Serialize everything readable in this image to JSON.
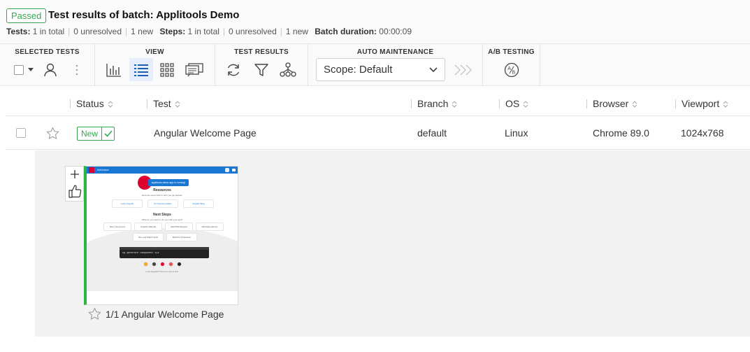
{
  "header": {
    "status": "Passed",
    "title": "Test results of batch: Applitools Demo",
    "tests_label": "Tests:",
    "tests_total": "1 in total",
    "tests_unresolved": "0 unresolved",
    "tests_new": "1 new",
    "steps_label": "Steps:",
    "steps_total": "1 in total",
    "steps_unresolved": "0 unresolved",
    "steps_new": "1 new",
    "duration_label": "Batch duration:",
    "duration_value": "00:00:09"
  },
  "toolbar": {
    "selected_tests": "SELECTED TESTS",
    "view": "VIEW",
    "test_results": "TEST RESULTS",
    "auto_maintenance": "AUTO MAINTENANCE",
    "ab_testing": "A/B TESTING",
    "scope_value": "Scope: Default"
  },
  "table": {
    "columns": [
      "Status",
      "Test",
      "Branch",
      "OS",
      "Browser",
      "Viewport"
    ],
    "row": {
      "status": "New",
      "test": "Angular Welcome Page",
      "branch": "default",
      "os": "Linux",
      "browser": "Chrome 89.0",
      "viewport": "1024x768"
    }
  },
  "step": {
    "caption": "1/1 Angular Welcome Page"
  },
  "thumbnail": {
    "app_title": "Welcome",
    "banner": "applitools-demo app is running!",
    "resources_title": "Resources",
    "resources_sub": "Here are some links to help you get started:",
    "links": [
      "Learn Angular",
      "CLI Documentation",
      "Angular Blog"
    ],
    "next_title": "Next Steps",
    "next_sub": "What do you want to do next with your app?",
    "steps_row1": [
      "New Component",
      "Angular Material",
      "Add PWA Support",
      "Add Dependency"
    ],
    "steps_row2": [
      "Run and Watch Tests",
      "Build for Production"
    ],
    "command": "ng generate component xyz",
    "footer": "Love Angular? Give our repo a star."
  },
  "colors": {
    "accent": "#35a853",
    "active_bg": "#e6eefb",
    "step_bar": "#2fb344"
  }
}
